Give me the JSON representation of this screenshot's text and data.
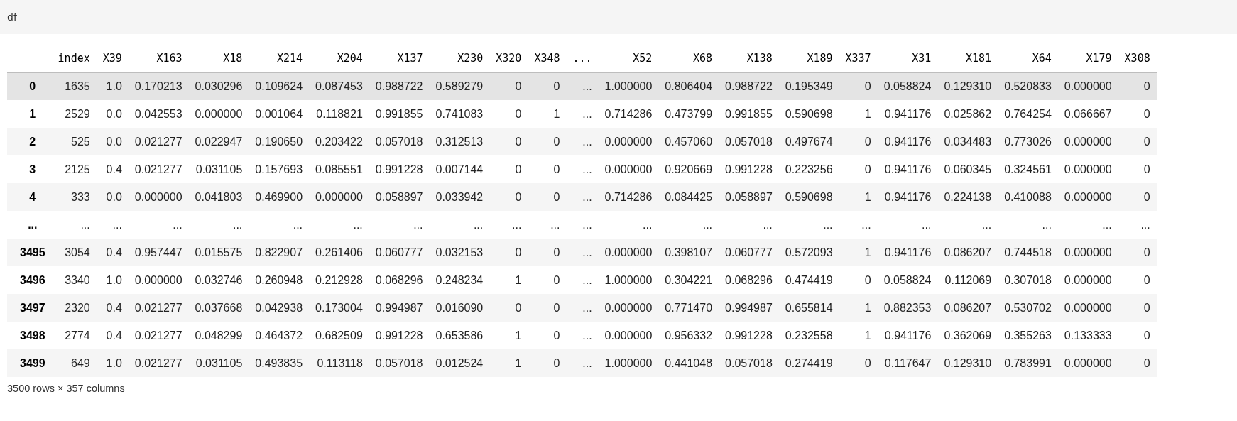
{
  "input_cell": {
    "code": "df"
  },
  "table": {
    "columns": [
      "",
      "index",
      "X39",
      "X163",
      "X18",
      "X214",
      "X204",
      "X137",
      "X230",
      "X320",
      "X348",
      "...",
      "X52",
      "X68",
      "X138",
      "X189",
      "X337",
      "X31",
      "X181",
      "X64",
      "X179",
      "X308"
    ],
    "rows": [
      {
        "highlighted": true,
        "cells": [
          "0",
          "1635",
          "1.0",
          "0.170213",
          "0.030296",
          "0.109624",
          "0.087453",
          "0.988722",
          "0.589279",
          "0",
          "0",
          "...",
          "1.000000",
          "0.806404",
          "0.988722",
          "0.195349",
          "0",
          "0.058824",
          "0.129310",
          "0.520833",
          "0.000000",
          "0"
        ]
      },
      {
        "highlighted": false,
        "cells": [
          "1",
          "2529",
          "0.0",
          "0.042553",
          "0.000000",
          "0.001064",
          "0.118821",
          "0.991855",
          "0.741083",
          "0",
          "1",
          "...",
          "0.714286",
          "0.473799",
          "0.991855",
          "0.590698",
          "1",
          "0.941176",
          "0.025862",
          "0.764254",
          "0.066667",
          "0"
        ]
      },
      {
        "highlighted": false,
        "cells": [
          "2",
          "525",
          "0.0",
          "0.021277",
          "0.022947",
          "0.190650",
          "0.203422",
          "0.057018",
          "0.312513",
          "0",
          "0",
          "...",
          "0.000000",
          "0.457060",
          "0.057018",
          "0.497674",
          "0",
          "0.941176",
          "0.034483",
          "0.773026",
          "0.000000",
          "0"
        ]
      },
      {
        "highlighted": false,
        "cells": [
          "3",
          "2125",
          "0.4",
          "0.021277",
          "0.031105",
          "0.157693",
          "0.085551",
          "0.991228",
          "0.007144",
          "0",
          "0",
          "...",
          "0.000000",
          "0.920669",
          "0.991228",
          "0.223256",
          "0",
          "0.941176",
          "0.060345",
          "0.324561",
          "0.000000",
          "0"
        ]
      },
      {
        "highlighted": false,
        "cells": [
          "4",
          "333",
          "0.0",
          "0.000000",
          "0.041803",
          "0.469900",
          "0.000000",
          "0.058897",
          "0.033942",
          "0",
          "0",
          "...",
          "0.714286",
          "0.084425",
          "0.058897",
          "0.590698",
          "1",
          "0.941176",
          "0.224138",
          "0.410088",
          "0.000000",
          "0"
        ]
      },
      {
        "highlighted": false,
        "cells": [
          "...",
          "...",
          "...",
          "...",
          "...",
          "...",
          "...",
          "...",
          "...",
          "...",
          "...",
          "...",
          "...",
          "...",
          "...",
          "...",
          "...",
          "...",
          "...",
          "...",
          "...",
          "..."
        ]
      },
      {
        "highlighted": false,
        "cells": [
          "3495",
          "3054",
          "0.4",
          "0.957447",
          "0.015575",
          "0.822907",
          "0.261406",
          "0.060777",
          "0.032153",
          "0",
          "0",
          "...",
          "0.000000",
          "0.398107",
          "0.060777",
          "0.572093",
          "1",
          "0.941176",
          "0.086207",
          "0.744518",
          "0.000000",
          "0"
        ]
      },
      {
        "highlighted": false,
        "cells": [
          "3496",
          "3340",
          "1.0",
          "0.000000",
          "0.032746",
          "0.260948",
          "0.212928",
          "0.068296",
          "0.248234",
          "1",
          "0",
          "...",
          "1.000000",
          "0.304221",
          "0.068296",
          "0.474419",
          "0",
          "0.058824",
          "0.112069",
          "0.307018",
          "0.000000",
          "0"
        ]
      },
      {
        "highlighted": false,
        "cells": [
          "3497",
          "2320",
          "0.4",
          "0.021277",
          "0.037668",
          "0.042938",
          "0.173004",
          "0.994987",
          "0.016090",
          "0",
          "0",
          "...",
          "0.000000",
          "0.771470",
          "0.994987",
          "0.655814",
          "1",
          "0.882353",
          "0.086207",
          "0.530702",
          "0.000000",
          "0"
        ]
      },
      {
        "highlighted": false,
        "cells": [
          "3498",
          "2774",
          "0.4",
          "0.021277",
          "0.048299",
          "0.464372",
          "0.682509",
          "0.991228",
          "0.653586",
          "1",
          "0",
          "...",
          "0.000000",
          "0.956332",
          "0.991228",
          "0.232558",
          "1",
          "0.941176",
          "0.362069",
          "0.355263",
          "0.133333",
          "0"
        ]
      },
      {
        "highlighted": false,
        "cells": [
          "3499",
          "649",
          "1.0",
          "0.021277",
          "0.031105",
          "0.493835",
          "0.113118",
          "0.057018",
          "0.012524",
          "1",
          "0",
          "...",
          "1.000000",
          "0.441048",
          "0.057018",
          "0.274419",
          "0",
          "0.117647",
          "0.129310",
          "0.783991",
          "0.000000",
          "0"
        ]
      }
    ],
    "footer": "3500 rows × 357 columns"
  }
}
